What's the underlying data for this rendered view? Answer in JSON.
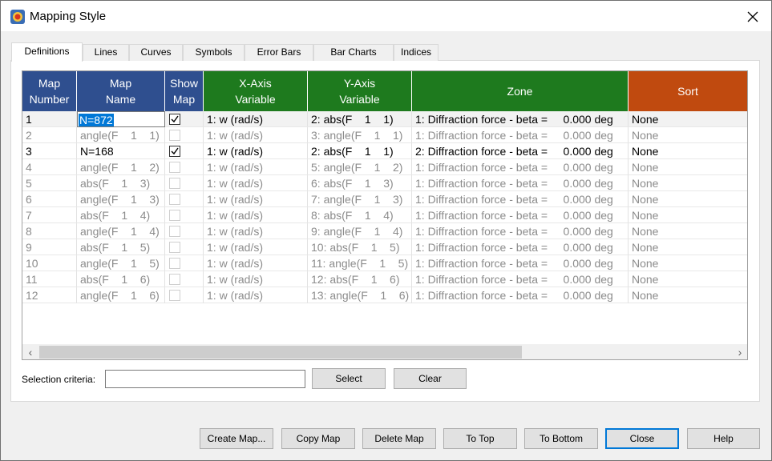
{
  "window": {
    "title": "Mapping Style",
    "close_icon": "close-icon"
  },
  "tabs": [
    "Definitions",
    "Lines",
    "Curves",
    "Symbols",
    "Error Bars",
    "Bar Charts",
    "Indices"
  ],
  "active_tab": "Definitions",
  "columns": [
    {
      "label": "Map\nNumber",
      "color": "#2f4f8f"
    },
    {
      "label": "Map\nName",
      "color": "#2f4f8f"
    },
    {
      "label": "Show\nMap",
      "color": "#2f4f8f"
    },
    {
      "label": "X-Axis\nVariable",
      "color": "#1e7a1e"
    },
    {
      "label": "Y-Axis\nVariable",
      "color": "#1e7a1e"
    },
    {
      "label": "Zone",
      "color": "#1e7a1e"
    },
    {
      "label": "Sort",
      "color": "#c04a0f"
    }
  ],
  "rows": [
    {
      "num": "1",
      "name": "N=872",
      "show": true,
      "x": "1: w (rad/s)",
      "y": "2: abs(F    1    1)",
      "zone": "1: Diffraction force - beta =     0.000 deg",
      "sort": "None",
      "active": true,
      "editing": true
    },
    {
      "num": "2",
      "name": "angle(F    1    1)",
      "show": false,
      "x": "1: w (rad/s)",
      "y": "3: angle(F    1    1)",
      "zone": "1: Diffraction force - beta =     0.000 deg",
      "sort": "None",
      "active": false
    },
    {
      "num": "3",
      "name": "N=168",
      "show": true,
      "x": "1: w (rad/s)",
      "y": "2: abs(F    1    1)",
      "zone": "2: Diffraction force - beta =     0.000 deg",
      "sort": "None",
      "active": true
    },
    {
      "num": "4",
      "name": "angle(F    1    2)",
      "show": false,
      "x": "1: w (rad/s)",
      "y": "5: angle(F    1    2)",
      "zone": "1: Diffraction force - beta =     0.000 deg",
      "sort": "None",
      "active": false
    },
    {
      "num": "5",
      "name": "abs(F    1    3)",
      "show": false,
      "x": "1: w (rad/s)",
      "y": "6: abs(F    1    3)",
      "zone": "1: Diffraction force - beta =     0.000 deg",
      "sort": "None",
      "active": false
    },
    {
      "num": "6",
      "name": "angle(F    1    3)",
      "show": false,
      "x": "1: w (rad/s)",
      "y": "7: angle(F    1    3)",
      "zone": "1: Diffraction force - beta =     0.000 deg",
      "sort": "None",
      "active": false
    },
    {
      "num": "7",
      "name": "abs(F    1    4)",
      "show": false,
      "x": "1: w (rad/s)",
      "y": "8: abs(F    1    4)",
      "zone": "1: Diffraction force - beta =     0.000 deg",
      "sort": "None",
      "active": false
    },
    {
      "num": "8",
      "name": "angle(F    1    4)",
      "show": false,
      "x": "1: w (rad/s)",
      "y": "9: angle(F    1    4)",
      "zone": "1: Diffraction force - beta =     0.000 deg",
      "sort": "None",
      "active": false
    },
    {
      "num": "9",
      "name": "abs(F    1    5)",
      "show": false,
      "x": "1: w (rad/s)",
      "y": "10: abs(F    1    5)",
      "zone": "1: Diffraction force - beta =     0.000 deg",
      "sort": "None",
      "active": false
    },
    {
      "num": "10",
      "name": "angle(F    1    5)",
      "show": false,
      "x": "1: w (rad/s)",
      "y": "11: angle(F    1    5)",
      "zone": "1: Diffraction force - beta =     0.000 deg",
      "sort": "None",
      "active": false
    },
    {
      "num": "11",
      "name": "abs(F    1    6)",
      "show": false,
      "x": "1: w (rad/s)",
      "y": "12: abs(F    1    6)",
      "zone": "1: Diffraction force - beta =     0.000 deg",
      "sort": "None",
      "active": false
    },
    {
      "num": "12",
      "name": "angle(F    1    6)",
      "show": false,
      "x": "1: w (rad/s)",
      "y": "13: angle(F    1    6)",
      "zone": "1: Diffraction force - beta =     0.000 deg",
      "sort": "None",
      "active": false
    }
  ],
  "selection": {
    "label": "Selection criteria:",
    "value": "",
    "select_button": "Select",
    "clear_button": "Clear"
  },
  "footer_buttons": [
    "Create Map...",
    "Copy Map",
    "Delete Map",
    "To Top",
    "To Bottom",
    "Close",
    "Help"
  ],
  "default_button": "Close"
}
